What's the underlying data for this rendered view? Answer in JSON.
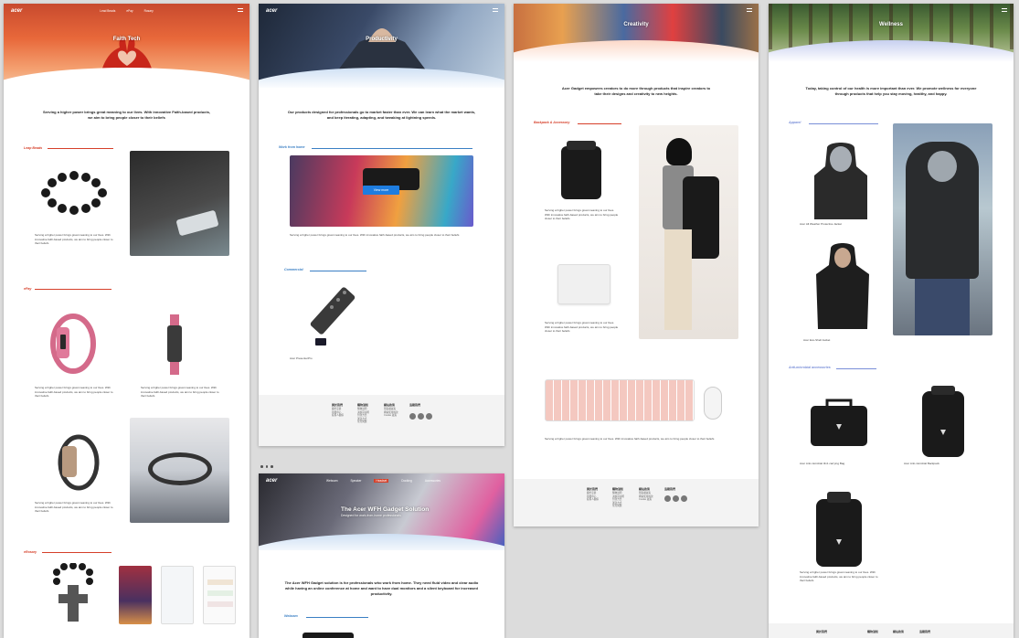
{
  "brand": {
    "logo": "acer"
  },
  "nav": {
    "items": [
      "Lead Beads",
      "ePay",
      "Rosary"
    ],
    "wfh_items": [
      "Webcam",
      "Speaker",
      "Headset",
      "Docking",
      "Accessories"
    ]
  },
  "faith": {
    "hero_title": "Faith Tech",
    "intro": "Serving a higher power brings great meaning to our lives. With innovative Faith-based products, we aim to bring people closer to their beliefs",
    "sections": [
      "Leap Beads",
      "ePay",
      "eRosary"
    ],
    "caption": "Serving a higher power brings great meaning to our lives. With innovative faith-based products, we aim to bring people closer to their beliefs",
    "accent": "#d6402a"
  },
  "productivity": {
    "hero_title": "Productivity",
    "intro": "Our products designed for professionals go to market faster than ever. We can learn what the market wants, and keep iterating, adapting, and tweaking at lightning speeds.",
    "section_wfh": "Work from home",
    "button": "View more",
    "caption": "Serving a higher power brings great meaning to our lives. With innovative faith-based products, we aim to bring people closer to their beliefs",
    "section_commercial": "Commercial",
    "product_name": "Acer PresenterPro",
    "accent": "#3a7fc4"
  },
  "wfh": {
    "hero_title": "The Acer WFH Gadget Solution",
    "hero_sub": "Designed for work-from-home professionals",
    "intro": "The Acer WFH Gadget solution is for professionals who work from home. They need fluid video and clear audio while having an online conference at home and want to have dual monitors and a silent keyboard for increased productivity.",
    "section": "Webcam"
  },
  "creativity": {
    "hero_title": "Creativity",
    "intro": "Acer Gadget empowers creators to do more through products that inspire creators to take their designs and creativity to new heights.",
    "section": "Backpack & Accessory",
    "caption": "Serving a higher power brings great meaning to our lives. With innovative faith-based products, we aim to bring people closer to their beliefs",
    "accent": "#d6402a"
  },
  "wellness": {
    "hero_title": "Wellness",
    "intro": "Today, taking control of our health is more important than ever. We promote wellness for everyone through products that help you stay moving, healthy, and happy.",
    "section_apparel": "Apparel",
    "item1": "Acer All Weather Protective Jacket",
    "item2": "Acer Eco-Shell Jacket",
    "section_anti": "Anti-microbial accessories",
    "bag1": "Acer Anti-microbial 3in1 carrying Bag",
    "bag2": "Acer Anti-microbial Backpack",
    "caption": "Serving a higher power brings great meaning to our lives. With innovative faith-based products, we aim to bring people closer to their beliefs",
    "accent": "#7a8fd8"
  },
  "footer": {
    "col1_title": "関於我們",
    "col1": [
      "關於宏碁",
      "新聞中心",
      "投資人關係"
    ],
    "col2_title": "購物須知",
    "col2": [
      "購物說明",
      "退換貨說明",
      "付款方式",
      "運送方式",
      "常見問題"
    ],
    "col3_title": "網站政策",
    "col3": [
      "隱私權政策",
      "網站使用條款",
      "Cookie 政策"
    ],
    "col4_title": "追蹤我們"
  }
}
